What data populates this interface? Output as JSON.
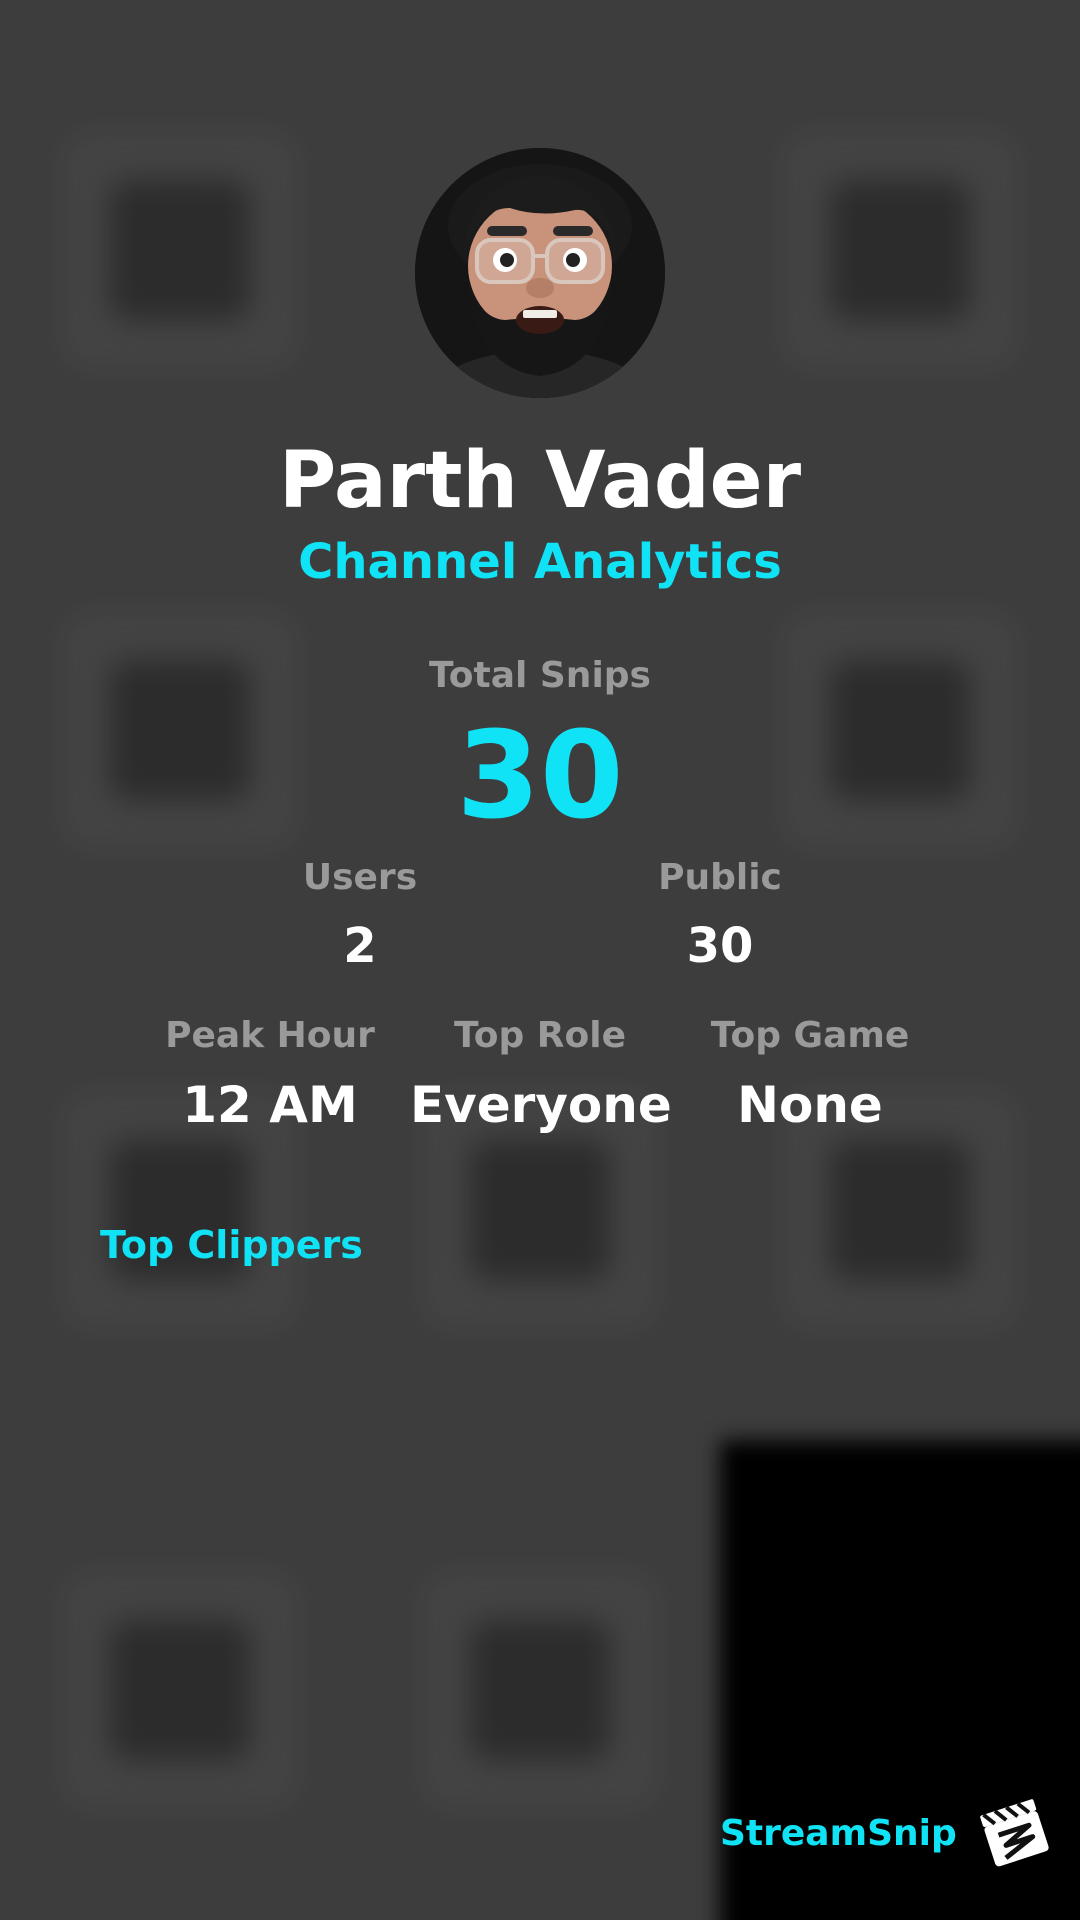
{
  "profile": {
    "name": "Parth Vader",
    "subtitle": "Channel Analytics"
  },
  "stats": {
    "total_label": "Total Snips",
    "total_value": "30",
    "users_label": "Users",
    "users_value": "2",
    "public_label": "Public",
    "public_value": "30",
    "peak_hour_label": "Peak Hour",
    "peak_hour_value": "12 AM",
    "top_role_label": "Top Role",
    "top_role_value": "Everyone",
    "top_game_label": "Top Game",
    "top_game_value": "None"
  },
  "sections": {
    "top_clippers_title": "Top Clippers"
  },
  "brand": {
    "name": "StreamSnip",
    "logo_icon": "clapperboard-icon"
  },
  "colors": {
    "accent": "#0fe3f5",
    "background": "#3d3d3d",
    "label": "#9a9a9a",
    "text": "#ffffff"
  }
}
